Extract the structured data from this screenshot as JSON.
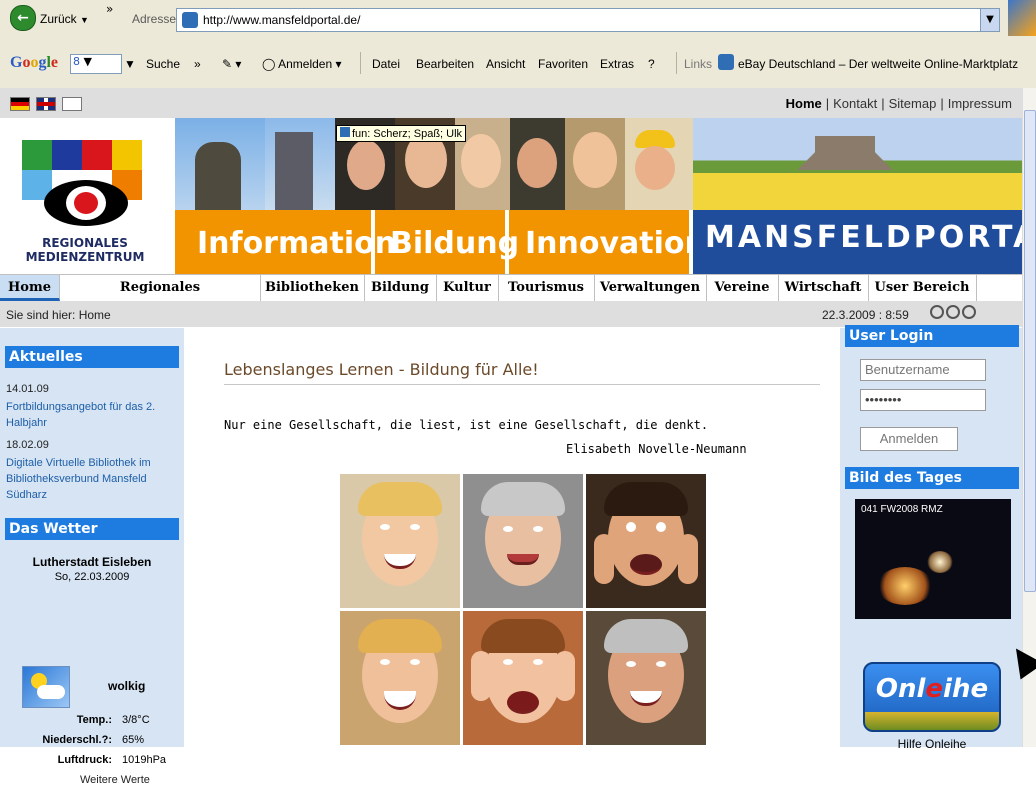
{
  "browser": {
    "back_label": "Zurück",
    "chevron": "»",
    "address_label": "Adresse",
    "url": "http://www.mansfeldportal.de/",
    "google": {
      "logo_letters": [
        "G",
        "o",
        "o",
        "g",
        "l",
        "e"
      ],
      "search_value": "8",
      "items": [
        "Suche",
        "»",
        "Anmelden"
      ],
      "menu": [
        "Datei",
        "Bearbeiten",
        "Ansicht",
        "Favoriten",
        "Extras",
        "?"
      ],
      "links_label": "Links",
      "ebay_link": "eBay Deutschland – Der weltweite Online-Marktplatz"
    }
  },
  "site": {
    "toplinks": [
      "Home",
      "Kontakt",
      "Sitemap",
      "Impressum"
    ],
    "tooltip": "fun: Scherz; Spaß; Ulk",
    "logo_line1": "REGIONALES",
    "logo_line2": "MEDIENZENTRUM",
    "banner_words": [
      "Information",
      "Bildung",
      "Innovation"
    ],
    "portal_title": "MANSFELDPORTAL",
    "nav": [
      "Home",
      "Regionales Medienzentrum",
      "Bibliotheken",
      "Bildung",
      "Kultur",
      "Tourismus",
      "Verwaltungen",
      "Vereine",
      "Wirtschaft",
      "User Bereich"
    ],
    "breadcrumb": "Sie sind hier: Home",
    "datetime": "22.3.2009 : 8:59",
    "left": {
      "news_heading": "Aktuelles",
      "news": [
        {
          "date": "14.01.09",
          "title": "Fortbildungsangebot für das 2. Halbjahr"
        },
        {
          "date": "18.02.09",
          "title": "Digitale Virtuelle Bibliothek im Bibliotheksverbund Mansfeld Südharz"
        }
      ],
      "weather_heading": "Das Wetter",
      "weather_city": "Lutherstadt Eisleben",
      "weather_date": "So, 22.03.2009",
      "weather_desc": "wolkig",
      "weather_rows": [
        {
          "label": "Temp.:",
          "value": "3/8°C"
        },
        {
          "label": "Niederschl.?:",
          "value": "65%"
        },
        {
          "label": "Luftdruck:",
          "value": "1019hPa"
        }
      ],
      "weather_more": "Weitere Werte"
    },
    "center": {
      "title": "Lebenslanges Lernen - Bildung für Alle!",
      "quote": "Nur eine Gesellschaft, die liest, ist eine Gesellschaft, die denkt.",
      "quote_author": "Elisabeth Novelle-Neumann"
    },
    "right": {
      "login_heading": "User Login",
      "username_placeholder": "Benutzername",
      "password_value": "••••••••",
      "login_button": "Anmelden",
      "potd_heading": "Bild des Tages",
      "potd_caption": "041 FW2008 RMZ",
      "onleihe_logo_parts": [
        "Onl",
        "e",
        "ihe"
      ],
      "onleihe_caption": "Hilfe Onleihe"
    }
  }
}
